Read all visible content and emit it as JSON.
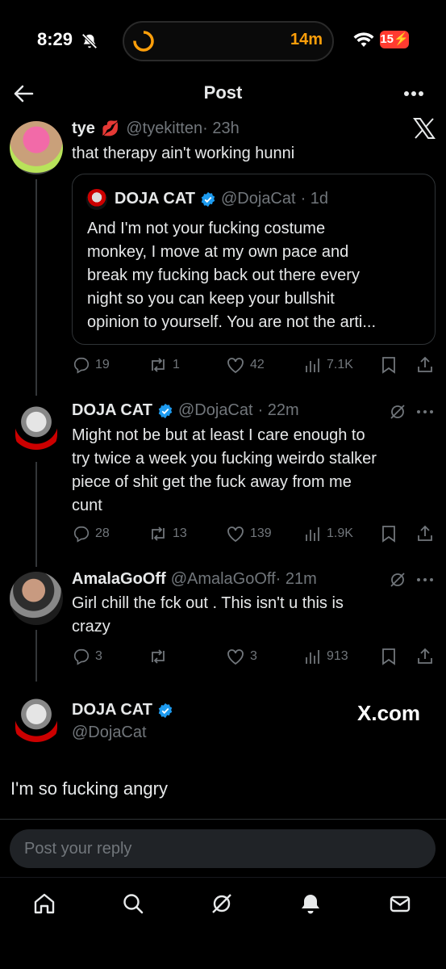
{
  "status_bar": {
    "time": "8:29",
    "timer": "14m",
    "battery": "15"
  },
  "header": {
    "title": "Post"
  },
  "watermark": {
    "domain": "X.com"
  },
  "posts": [
    {
      "name": "tye",
      "emoji": "💋",
      "handle": "@tyekitten",
      "time": "· 23h",
      "text": "that therapy ain't working hunni",
      "quote": {
        "name": "DOJA CAT",
        "handle": "@DojaCat",
        "time": "· 1d",
        "lines": [
          "And I'm not your fucking costume",
          "monkey, I move at my own pace and",
          "break my fucking back out there every",
          "night so you can keep your bullshit",
          "opinion to yourself. You are not the arti..."
        ]
      },
      "replies": "19",
      "reposts": "1",
      "likes": "42",
      "views": "7.1K"
    },
    {
      "name": "DOJA CAT",
      "handle": "@DojaCat",
      "time": "· 22m",
      "lines": [
        "Might not be but at least I care enough to",
        "try twice a week you fucking weirdo stalker",
        "piece of shit get the fuck away from me",
        "cunt"
      ],
      "replies": "28",
      "reposts": "13",
      "likes": "139",
      "views": "1.9K"
    },
    {
      "name": "AmalaGoOff",
      "handle": "@AmalaGoOff",
      "time": "· 21m",
      "lines": [
        "Girl chill the fck out . This isn't u this is",
        "crazy"
      ],
      "replies": "3",
      "reposts": "",
      "likes": "3",
      "views": "913"
    },
    {
      "name": "DOJA CAT",
      "handle": "@DojaCat",
      "text": "I'm so fucking angry"
    }
  ],
  "composer": {
    "placeholder": "Post your reply"
  },
  "colors": {
    "accent": "#1d9bf0",
    "muted": "#71767b",
    "timer": "#ff9f0a",
    "battery": "#ff3b30",
    "heart": "#f91880"
  }
}
